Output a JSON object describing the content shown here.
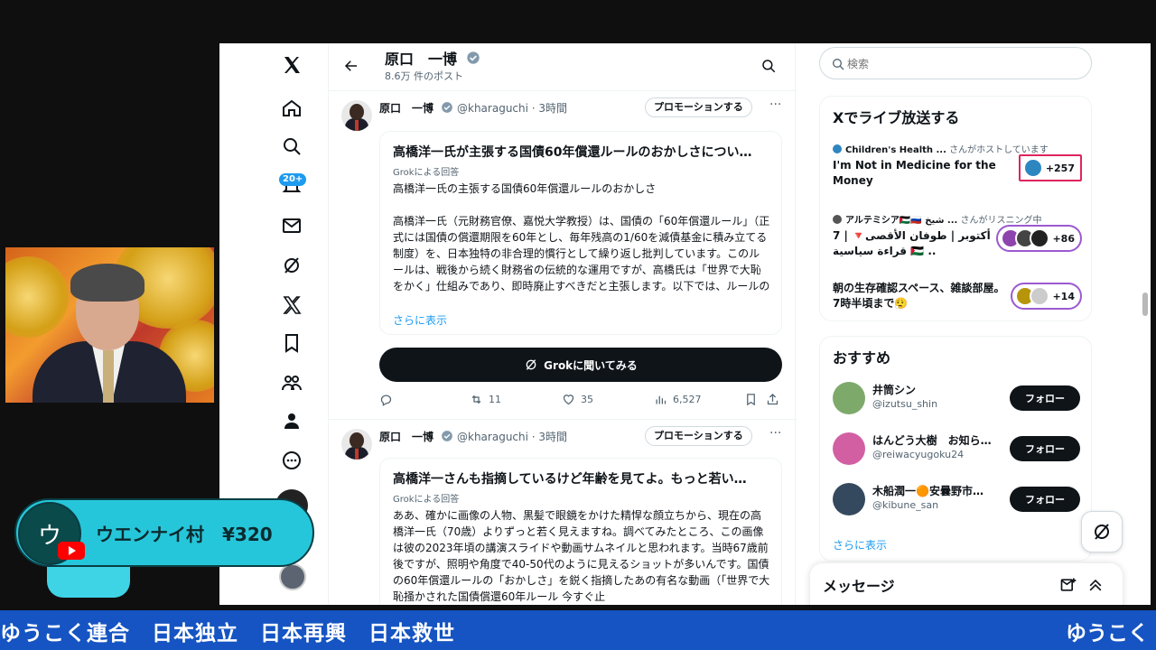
{
  "profile": {
    "name": "原口　一博",
    "post_count": "8.6万 件のポスト"
  },
  "nav": {
    "badge": "20+"
  },
  "tweets": [
    {
      "name": "原口　一博",
      "handle": "@kharaguchi · 3時間",
      "promo": "プロモーションする",
      "card_title": "高橋洋一氏が主張する国債60年償還ルールのおかしさについ…",
      "card_sub": "Grokによる回答",
      "body_lead": "高橋洋一氏の主張する国債60年償還ルールのおかしさ",
      "body_main": "高橋洋一氏（元財務官僚、嘉悦大学教授）は、国債の「60年償還ルール」（正式には国債の償還期限を60年とし、毎年残高の1/60を減債基金に積み立てる制度）を、日本独特の非合理的慣行として繰り返し批判しています。このルールは、戦後から続く財務省の伝統的な運用ですが、高橋氏は「世界で大恥をかく」仕組みであり、即時廃止すべきだと主張します。以下では、ルールの概要とその「おかしさ」の主なポイント…",
      "show_more": "さらに表示",
      "grok_button": "Grokに聞いてみる",
      "replies": "",
      "reposts": "11",
      "likes": "35",
      "views": "6,527"
    },
    {
      "name": "原口　一博",
      "handle": "@kharaguchi · 3時間",
      "promo": "プロモーションする",
      "card_title": "高橋洋一さんも指摘しているけど年齢を見てよ。もっと若い…",
      "card_sub": "Grokによる回答",
      "body_main": "ああ、確かに画像の人物、黒髪で眼鏡をかけた精悍な顔立ちから、現在の高橋洋一氏（70歳）よりずっと若く見えますね。調べてみたところ、この画像は彼の2023年頃の講演スライドや動画サムネイルと思われます。当時67歳前後ですが、照明や角度で40-50代のように見えるショットが多いんです。国債の60年償還ルールの「おかしさ」を鋭く指摘したあの有名な動画（「世界で大恥掻かされた国債償還60年ルール 今すぐ止"
    }
  ],
  "search": {
    "placeholder": "検索"
  },
  "live": {
    "title": "Xでライブ放送する",
    "items": [
      {
        "host": "Children's Health ...",
        "host_suffix": "さんがホストしています",
        "title": "I'm Not in Medicine for the Money",
        "count": "+257"
      },
      {
        "host": "アルテミシア🇵🇸🇷🇺 شيخ ...",
        "host_suffix": "さんがリスニング中",
        "title": "7 أكتوبر | طوفان الأقصى🔻 | قراءة سياسية 🇵🇸 ..",
        "count": "+86"
      },
      {
        "title": "朝の生存確認スペース、雑談部屋。7時半頃まで😮‍💨",
        "count": "+14"
      }
    ]
  },
  "recommend": {
    "title": "おすすめ",
    "items": [
      {
        "name": "井筒シン",
        "handle": "@izutsu_shin",
        "follow": "フォロー"
      },
      {
        "name": "はんどう大樹　お知ら…",
        "handle": "@reiwacyugoku24",
        "follow": "フォロー"
      },
      {
        "name": "木船潤一🟠安曇野市…",
        "handle": "@kibune_san",
        "follow": "フォロー"
      }
    ],
    "show_more": "さらに表示"
  },
  "messages": {
    "title": "メッセージ"
  },
  "superchat": {
    "initial": "ウ",
    "text": "ウエンナイ村　¥320"
  },
  "ticker": {
    "text": "ゆうこく連合　日本独立　日本再興　日本救世",
    "tail": "ゆうこく"
  },
  "colors": {
    "accent": "#1d9bf0",
    "ticker_bg": "#1554c2",
    "superchat_bg": "#26c6da"
  }
}
